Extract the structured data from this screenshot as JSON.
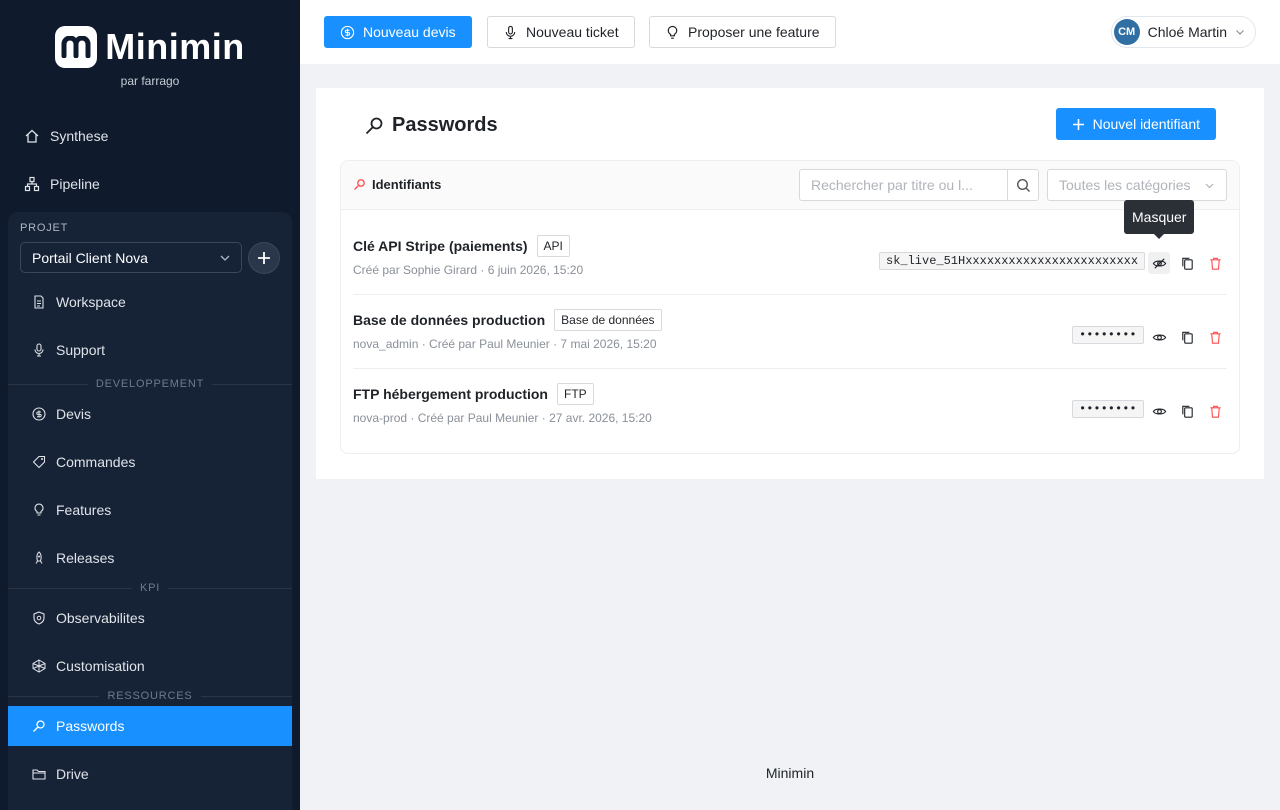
{
  "brand": {
    "name": "Minimin",
    "subtitle": "par farrago"
  },
  "sidebar": {
    "top_items": [
      {
        "label": "Synthese",
        "icon": "home-icon"
      },
      {
        "label": "Pipeline",
        "icon": "pipeline-icon"
      }
    ],
    "project_label": "PROJET",
    "project_selected": "Portail Client Nova",
    "project_items": [
      {
        "label": "Workspace",
        "icon": "file-icon"
      },
      {
        "label": "Support",
        "icon": "microphone-icon"
      }
    ],
    "section_dev": "DEVELOPPEMENT",
    "dev_items": [
      {
        "label": "Devis",
        "icon": "dollar-icon"
      },
      {
        "label": "Commandes",
        "icon": "tag-icon"
      },
      {
        "label": "Features",
        "icon": "bulb-icon"
      },
      {
        "label": "Releases",
        "icon": "rocket-icon"
      }
    ],
    "section_kpi": "KPI",
    "kpi_items": [
      {
        "label": "Observabilites",
        "icon": "shield-icon"
      },
      {
        "label": "Customisation",
        "icon": "code-icon"
      }
    ],
    "section_resources": "RESSOURCES",
    "resource_items": [
      {
        "label": "Passwords",
        "icon": "key-icon"
      },
      {
        "label": "Drive",
        "icon": "folder-icon"
      }
    ]
  },
  "topbar": {
    "new_quote": "Nouveau devis",
    "new_ticket": "Nouveau ticket",
    "propose_feature": "Proposer une feature",
    "user_initials": "CM",
    "user_name": "Chloé Martin"
  },
  "main": {
    "title": "Passwords",
    "new_button": "Nouvel identifiant",
    "card_title": "Identifiants",
    "search_placeholder": "Rechercher par titre ou l...",
    "category_placeholder": "Toutes les catégories",
    "tooltip": "Masquer",
    "rows": [
      {
        "title": "Clé API Stripe (paiements)",
        "tag": "API",
        "meta": "Créé par Sophie Girard · 6 juin 2026, 15:20",
        "secret": "sk_live_51Hxxxxxxxxxxxxxxxxxxxxxxxx",
        "revealed": true
      },
      {
        "title": "Base de données production",
        "tag": "Base de données",
        "meta": "nova_admin · Créé par Paul Meunier · 7 mai 2026, 15:20",
        "secret": "••••••••",
        "revealed": false
      },
      {
        "title": "FTP hébergement production",
        "tag": "FTP",
        "meta": "nova-prod · Créé par Paul Meunier · 27 avr. 2026, 15:20",
        "secret": "••••••••",
        "revealed": false
      }
    ]
  },
  "footer": {
    "text": "Minimin"
  },
  "colors": {
    "sidebar_bg": "#0f1b2d",
    "accent": "#1890ff",
    "delete": "#ff4d4f"
  }
}
